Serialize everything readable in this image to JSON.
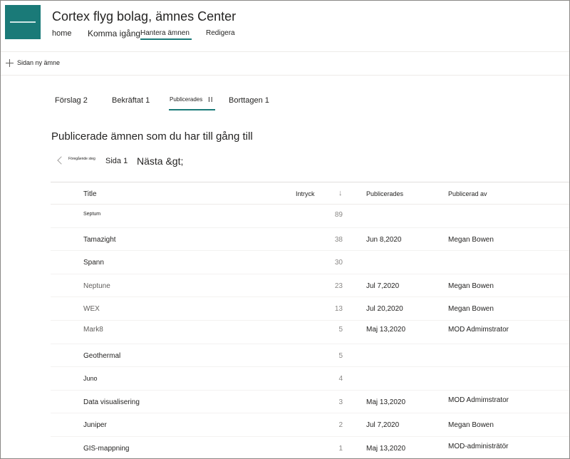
{
  "site": {
    "title": "Cortex flyg bolag, ämnes Center"
  },
  "nav": {
    "home": "home",
    "start": "Komma igång",
    "manage": "Hantera ämnen",
    "edit": "Redigera"
  },
  "commands": {
    "new_topic": "Sidan ny ämne"
  },
  "tabs": {
    "suggested": "Förslag 2",
    "confirmed": "Bekräftat 1",
    "published": "Publicerades",
    "published_suffix": "II",
    "removed": "Borttagen 1"
  },
  "section": {
    "title": "Publicerade ämnen som du har till gång till"
  },
  "pager": {
    "prev": "Föregående steg",
    "page": "Sida 1",
    "next": "Nästa &gt;"
  },
  "columns": {
    "title": "Title",
    "views": "Intryck",
    "sort": "↓",
    "published": "Publicerades",
    "published_by": "Publicerad av"
  },
  "rows": [
    {
      "title": "Septum",
      "views": "89",
      "published": "",
      "by": ""
    },
    {
      "title": "Tamazight",
      "views": "38",
      "published": "Jun 8,2020",
      "by": "Megan Bowen"
    },
    {
      "title": "Spann",
      "views": "30",
      "published": "",
      "by": ""
    },
    {
      "title": "Neptune",
      "views": "23",
      "published": "Jul 7,2020",
      "by": "Megan Bowen"
    },
    {
      "title": "WEX",
      "views": "13",
      "published": "Jul 20,2020",
      "by": "Megan Bowen"
    },
    {
      "title": "Mark8",
      "views": "5",
      "published": "Maj 13,2020",
      "by": "MOD Admimstrator"
    },
    {
      "title": "Geothermal",
      "views": "5",
      "published": "",
      "by": ""
    },
    {
      "title": "Juno",
      "views": "4",
      "published": "",
      "by": ""
    },
    {
      "title": "Data visualisering",
      "views": "3",
      "published": "Maj 13,2020",
      "by": "MOD Admimstrator"
    },
    {
      "title": "Juniper",
      "views": "2",
      "published": "Jul 7,2020",
      "by": "Megan Bowen"
    },
    {
      "title": "GIS-mappning",
      "views": "1",
      "published": "Maj 13,2020",
      "by": "MOD-administrätör"
    }
  ],
  "colors": {
    "accent": "#1a7a78"
  }
}
